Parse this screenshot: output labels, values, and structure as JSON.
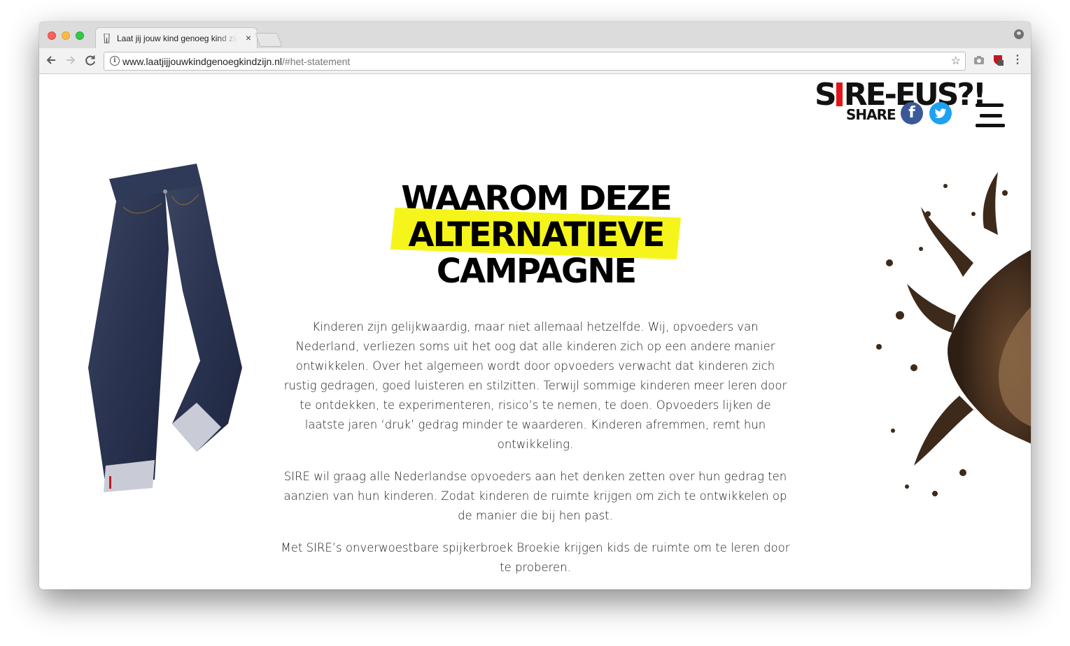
{
  "browser": {
    "tab_title": "Laat jij jouw kind genoeg kind zijn",
    "tab_close": "×",
    "url_host": "www.laatjijjouwkindgenoegkindzijn.nl",
    "url_path": "/#het-statement",
    "icons": [
      "back-icon",
      "forward-icon",
      "reload-icon",
      "info-icon",
      "star-icon",
      "camera-icon",
      "extension-icon",
      "menu-icon",
      "profile-icon"
    ]
  },
  "header": {
    "logo": {
      "part1": "S",
      "part2": "RE-EUS?!"
    },
    "share_label": "SHARE",
    "facebook_glyph": "f",
    "twitter_glyph": "t"
  },
  "main": {
    "heading_line1": "WAAROM DEZE",
    "heading_line2": "ALTERNATIEVE",
    "heading_line3": "CAMPAGNE",
    "paragraphs": [
      "Kinderen zijn gelijkwaardig, maar niet allemaal hetzelfde. Wij, opvoeders van Nederland, verliezen soms uit het oog dat alle kinderen zich op een andere manier ontwikkelen. Over het algemeen wordt door opvoeders verwacht dat kinderen zich rustig gedragen, goed luisteren en stilzitten. Terwijl sommige kinderen meer leren door te ontdekken, te experimenteren, risico’s te nemen, te doen. Opvoeders lijken de laatste jaren ‘druk’ gedrag minder te waarderen. Kinderen afremmen, remt hun ontwikkeling.",
      "SIRE wil graag alle Nederlandse opvoeders aan het denken zetten over hun gedrag ten aanzien van hun kinderen. Zodat kinderen de ruimte krijgen om zich te ontwikkelen op de manier die bij hen past.",
      "Met SIRE’s onverwoestbare spijkerbroek Broekie krijgen kids de ruimte om te leren door te proberen."
    ]
  },
  "colors": {
    "highlight": "#f5f51b",
    "logo_red": "#e3151b",
    "facebook": "#3b5998",
    "twitter": "#1da1f2"
  }
}
